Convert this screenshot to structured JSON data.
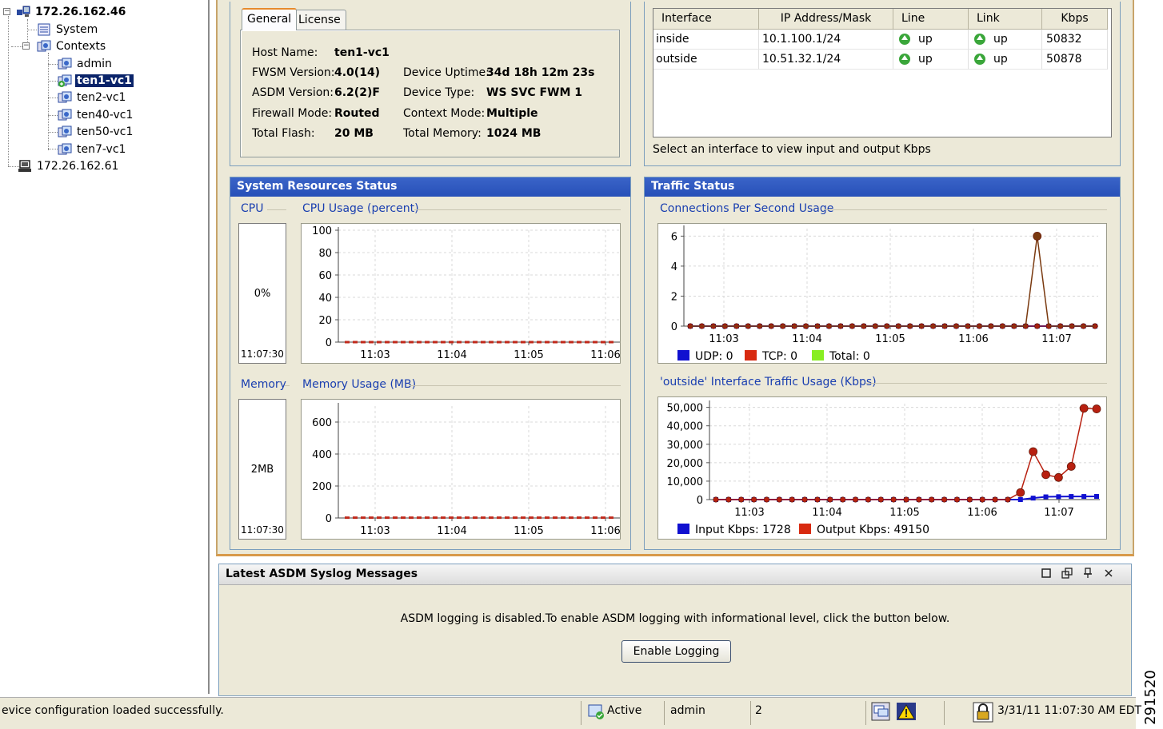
{
  "tree": {
    "root": "172.26.162.46",
    "system": "System",
    "contexts": "Contexts",
    "items": [
      "admin",
      "ten1-vc1",
      "ten2-vc1",
      "ten40-vc1",
      "ten50-vc1",
      "ten7-vc1"
    ],
    "selected": "ten1-vc1",
    "host2": "172.26.162.61"
  },
  "general": {
    "tabs": [
      "General",
      "License"
    ],
    "host_name_label": "Host Name:",
    "host_name": "ten1-vc1",
    "fwsm_label": "FWSM Version:",
    "fwsm": "4.0(14)",
    "asdm_label": "ASDM Version:",
    "asdm": "6.2(2)F",
    "fwmode_label": "Firewall Mode:",
    "fwmode": "Routed",
    "flash_label": "Total Flash:",
    "flash": "20 MB",
    "uptime_label": "Device Uptime:",
    "uptime": "34d 18h 12m 23s",
    "devtype_label": "Device Type:",
    "devtype": "WS SVC FWM 1",
    "ctxmode_label": "Context Mode:",
    "ctxmode": "Multiple",
    "memory_label": "Total Memory:",
    "memory": "1024 MB"
  },
  "interfaces": {
    "headers": [
      "Interface",
      "IP Address/Mask",
      "Line",
      "Link",
      "Kbps"
    ],
    "rows": [
      {
        "name": "inside",
        "ip": "10.1.100.1/24",
        "line": "up",
        "link": "up",
        "kbps": "50832"
      },
      {
        "name": "outside",
        "ip": "10.51.32.1/24",
        "line": "up",
        "link": "up",
        "kbps": "50878"
      }
    ],
    "hint": "Select an interface to view input and output Kbps",
    "status_color": "#3aa63a"
  },
  "system_resources": {
    "title": "System Resources Status",
    "cpu_label": "CPU",
    "cpu_value": "0%",
    "cpu_time": "11:07:30",
    "cpu_chart_title": "CPU Usage (percent)",
    "memory_label": "Memory",
    "memory_value": "2MB",
    "memory_time": "11:07:30",
    "memory_chart_title": "Memory Usage (MB)"
  },
  "traffic": {
    "title": "Traffic Status",
    "cps_title": "Connections Per Second Usage",
    "legend1": [
      {
        "label": "UDP: 0",
        "color": "#1010d0"
      },
      {
        "label": "TCP: 0",
        "color": "#d82a10"
      },
      {
        "label": "Total: 0",
        "color": "#88ee22"
      }
    ],
    "iface_title": "'outside' Interface Traffic Usage (Kbps)",
    "legend2": [
      {
        "label": "Input Kbps: 1728",
        "color": "#1010d0"
      },
      {
        "label": "Output Kbps: 49150",
        "color": "#d82a10"
      }
    ]
  },
  "chart_data": [
    {
      "type": "line",
      "title": "CPU Usage (percent)",
      "xticks": [
        "11:03",
        "11:04",
        "11:05",
        "11:06"
      ],
      "yticks": [
        "0",
        "20",
        "40",
        "60",
        "80",
        "100"
      ],
      "ylim": [
        0,
        100
      ],
      "series": [
        {
          "values": [
            0,
            0,
            0,
            0,
            0,
            0,
            0,
            0,
            0,
            0,
            0,
            0,
            0,
            0,
            0,
            0,
            0,
            0,
            0,
            0,
            0,
            0,
            0,
            0,
            0,
            0,
            0,
            0,
            0,
            0,
            0,
            0,
            0,
            0,
            0,
            0
          ],
          "color": "#c0281a"
        }
      ]
    },
    {
      "type": "line",
      "title": "Memory Usage (MB)",
      "xticks": [
        "11:03",
        "11:04",
        "11:05",
        "11:06"
      ],
      "yticks": [
        "0",
        "200",
        "400",
        "600"
      ],
      "ylim": [
        0,
        700
      ],
      "series": [
        {
          "values": [
            2,
            2,
            2,
            2,
            2,
            2,
            2,
            2,
            2,
            2,
            2,
            2,
            2,
            2,
            2,
            2,
            2,
            2,
            2,
            2,
            2,
            2,
            2,
            2,
            2,
            2,
            2,
            2,
            2,
            2,
            2,
            2,
            2,
            2,
            2,
            2
          ],
          "color": "#c0281a"
        }
      ]
    },
    {
      "type": "line",
      "title": "Connections Per Second Usage",
      "xticks": [
        "11:03",
        "11:04",
        "11:05",
        "11:06",
        "11:07"
      ],
      "yticks": [
        "0",
        "2",
        "4",
        "6"
      ],
      "ylim": [
        0,
        6.5
      ],
      "series": [
        {
          "name": "UDP",
          "color": "#1010d0",
          "values": [
            0,
            0,
            0,
            0,
            0,
            0,
            0,
            0,
            0,
            0,
            0,
            0,
            0,
            0,
            0,
            0,
            0,
            0,
            0,
            0,
            0,
            0,
            0,
            0,
            0,
            0,
            0,
            0,
            0,
            0,
            0,
            0,
            0,
            0,
            0,
            0
          ]
        },
        {
          "name": "TCP",
          "color": "#a82010",
          "values": [
            0,
            0,
            0,
            0,
            0,
            0,
            0,
            0,
            0,
            0,
            0,
            0,
            0,
            0,
            0,
            0,
            0,
            0,
            0,
            0,
            0,
            0,
            0,
            0,
            0,
            0,
            0,
            0,
            0,
            0,
            0,
            0,
            0,
            0,
            0,
            0
          ]
        },
        {
          "name": "Total",
          "color": "#7a3a10",
          "values": [
            0,
            0,
            0,
            0,
            0,
            0,
            0,
            0,
            0,
            0,
            0,
            0,
            0,
            0,
            0,
            0,
            0,
            0,
            0,
            0,
            0,
            0,
            0,
            0,
            0,
            0,
            0,
            0,
            0,
            0,
            6,
            0,
            0,
            0,
            0,
            0
          ]
        }
      ]
    },
    {
      "type": "line",
      "title": "'outside' Interface Traffic Usage (Kbps)",
      "xticks": [
        "11:03",
        "11:04",
        "11:05",
        "11:06",
        "11:07"
      ],
      "yticks": [
        "0",
        "10,000",
        "20,000",
        "30,000",
        "40,000",
        "50,000"
      ],
      "ylim": [
        0,
        52000
      ],
      "series": [
        {
          "name": "Input Kbps",
          "color": "#1010d0",
          "values": [
            0,
            0,
            0,
            0,
            0,
            0,
            0,
            0,
            0,
            0,
            0,
            0,
            0,
            0,
            0,
            0,
            0,
            0,
            0,
            0,
            0,
            0,
            0,
            0,
            0,
            800,
            1500,
            1600,
            1700,
            1700,
            1728
          ]
        },
        {
          "name": "Output Kbps",
          "color": "#b82010",
          "values": [
            0,
            0,
            0,
            0,
            0,
            0,
            0,
            0,
            0,
            0,
            0,
            0,
            0,
            0,
            0,
            0,
            0,
            0,
            0,
            0,
            0,
            0,
            0,
            0,
            3800,
            26000,
            13500,
            12000,
            18000,
            49500,
            49150
          ]
        }
      ]
    }
  ],
  "syslog": {
    "title": "Latest ASDM Syslog Messages",
    "message": "ASDM logging is disabled.To enable ASDM logging with informational level, click the button below.",
    "button": "Enable Logging"
  },
  "statusbar": {
    "message": "evice configuration loaded successfully.",
    "state": "Active",
    "user": "admin",
    "count": "2",
    "datetime": "3/31/11 11:07:30 AM EDT"
  },
  "figure_number": "291520"
}
